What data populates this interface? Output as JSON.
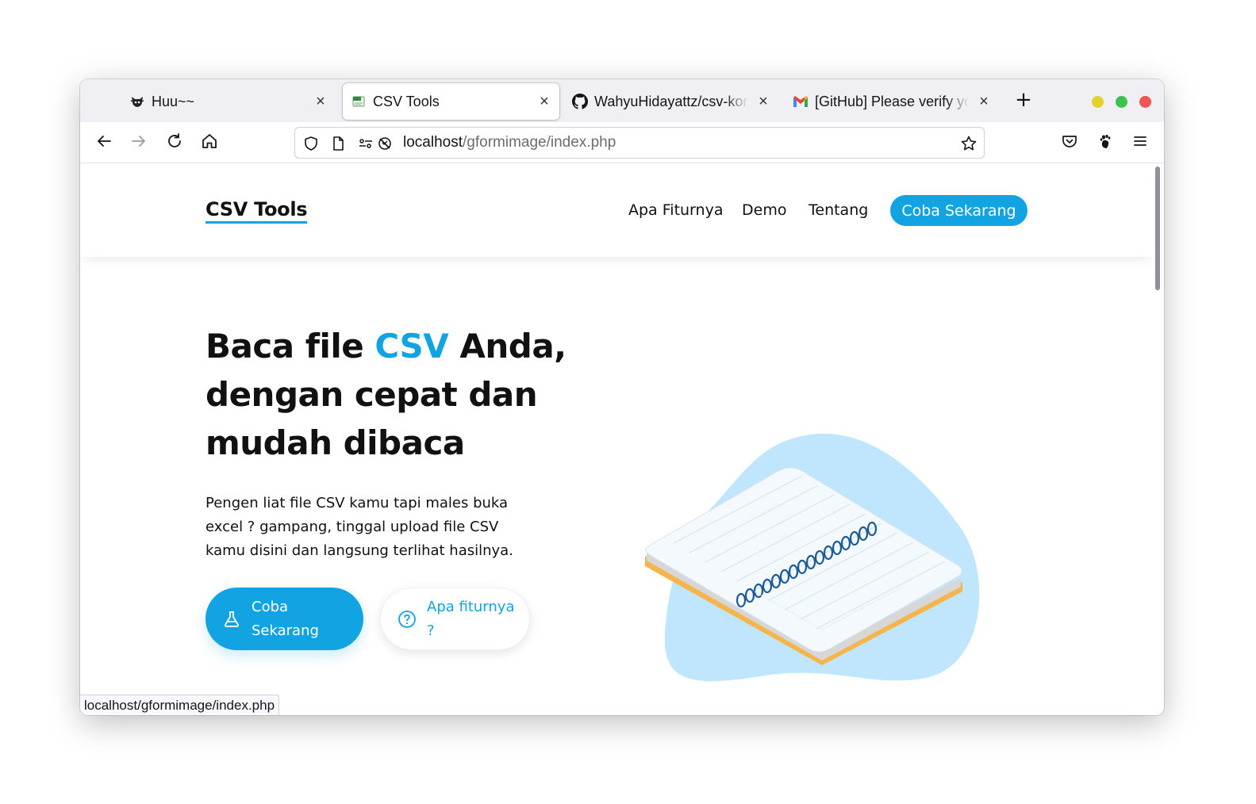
{
  "browser": {
    "tabs": [
      {
        "label": "Huu~~",
        "icon": "ninja-cat-icon",
        "active": false
      },
      {
        "label": "CSV Tools",
        "icon": "csv-file-icon",
        "active": true
      },
      {
        "label": "WahyuHidayattz/csv-konverter",
        "icon": "github-icon",
        "active": false
      },
      {
        "label": "[GitHub] Please verify your device",
        "icon": "gmail-icon",
        "active": false
      }
    ],
    "tab_close": "×",
    "new_tab": "+",
    "url_host": "localhost",
    "url_path": "/gformimage/index.php",
    "status_url": "localhost/gformimage/index.php",
    "traffic_colors": {
      "minimize": "#e5d12b",
      "maximize": "#3ec24d",
      "close": "#ee5650"
    }
  },
  "site": {
    "brand": "CSV Tools",
    "menu": [
      "Apa Fiturnya",
      "Demo",
      "Tentang"
    ],
    "cta": "Coba Sekarang",
    "accent_color": "#12a3e3"
  },
  "hero": {
    "title_part1": "Baca file ",
    "title_accent": "CSV",
    "title_part2": " Anda, dengan cepat dan mudah ",
    "title_strong": "dibaca",
    "description": "Pengen liat file CSV kamu tapi males buka excel ? gampang, tinggal upload file CSV kamu disini dan langsung terlihat hasilnya.",
    "primary_button": "Coba Sekarang",
    "secondary_button": "Apa fiturnya ?"
  }
}
